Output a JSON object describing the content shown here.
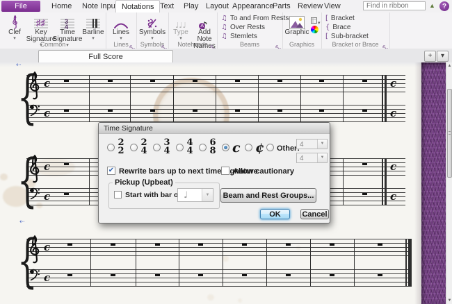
{
  "ribbon": {
    "file_tab": "File",
    "tabs": [
      "Home",
      "Note Input",
      "Notations",
      "Text",
      "Play",
      "Layout",
      "Appearance",
      "Parts",
      "Review",
      "View"
    ],
    "active_tab": "Notations",
    "find_placeholder": "Find in ribbon",
    "help_icon": "?",
    "groups": {
      "common": {
        "label": "Common",
        "clef": "Clef",
        "key_signature": "Key Signature",
        "time_signature": "Time Signature",
        "barline": "Barline"
      },
      "lines": {
        "label": "Lines",
        "button": "Lines"
      },
      "symbols": {
        "label": "Symbols",
        "button": "Symbols"
      },
      "noteheads": {
        "label": "Noteheads",
        "type": "Type",
        "add_note_names": "Add Note Names"
      },
      "beams": {
        "label": "Beams",
        "items": [
          "To and From Rests",
          "Over Rests",
          "Stemlets"
        ]
      },
      "graphics": {
        "label": "Graphics",
        "button": "Graphic"
      },
      "bracket": {
        "label": "Bracket or Brace",
        "items": [
          "Bracket",
          "Brace",
          "Sub-bracket"
        ]
      }
    }
  },
  "doc_tabbar": {
    "document_tab": "Full Score",
    "new_tab_button": "+"
  },
  "dialog": {
    "title": "Time Signature",
    "time_options": [
      {
        "num": "2",
        "den": "2",
        "selected": false
      },
      {
        "num": "2",
        "den": "4",
        "selected": false
      },
      {
        "num": "3",
        "den": "4",
        "selected": false
      },
      {
        "num": "4",
        "den": "4",
        "selected": false
      },
      {
        "num": "6",
        "den": "8",
        "selected": false
      },
      {
        "glyph": "c",
        "name": "common-time",
        "selected": true
      },
      {
        "glyph": "¢",
        "name": "cut-common-time",
        "selected": false
      }
    ],
    "other_label": "Other:",
    "other_numerator": "4",
    "other_denominator": "4",
    "rewrite_checkbox": {
      "label": "Rewrite bars up to next time signature",
      "checked": true
    },
    "cautionary_checkbox": {
      "label": "Allow cautionary",
      "checked": false
    },
    "pickup_group": {
      "label": "Pickup (Upbeat)",
      "checkbox_label": "Start with bar of length:",
      "checked": false,
      "note_value": "♩"
    },
    "beam_button": "Beam and Rest Groups...",
    "ok": "OK",
    "cancel": "Cancel"
  },
  "score": {
    "time_signature_glyph": "c",
    "staves": [
      "treble",
      "bass"
    ],
    "systems": [
      {
        "bars": 8,
        "end": "double-barline",
        "courtesy_timesig": true
      },
      {
        "bars": 8,
        "end": "double-barline",
        "courtesy_timesig": true
      },
      {
        "bars": 8,
        "end": "final-barline",
        "courtesy_timesig": false
      }
    ]
  },
  "colors": {
    "accent_purple": "#7b2f8e",
    "file_tab_purple": "#8a3f9e",
    "paper": "#f6f5f1",
    "leather_purple": "#6f3d7e",
    "radio_selected_blue": "#2d6096"
  }
}
